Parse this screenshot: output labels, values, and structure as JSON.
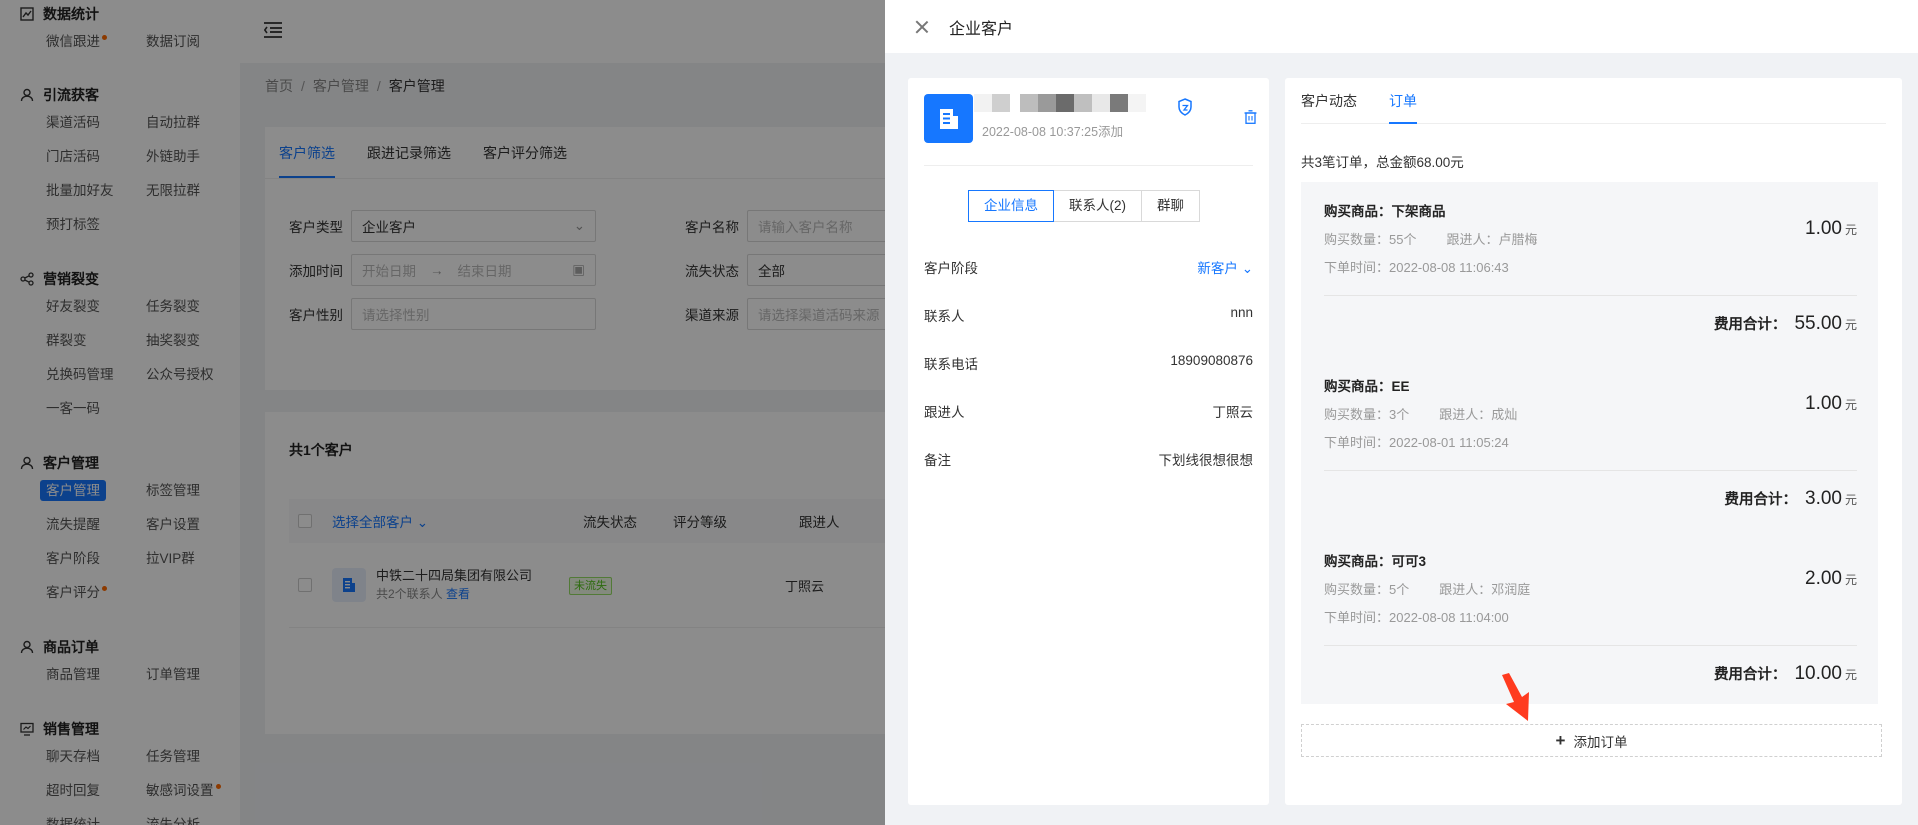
{
  "sidebar": {
    "groups": [
      {
        "title": "数据统计",
        "items": [
          "微信跟进",
          "数据订阅"
        ]
      },
      {
        "title": "引流获客",
        "items": [
          "渠道活码",
          "自动拉群",
          "门店活码",
          "外链助手",
          "批量加好友",
          "无限拉群",
          "预打标签"
        ]
      },
      {
        "title": "营销裂变",
        "items": [
          "好友裂变",
          "任务裂变",
          "群裂变",
          "抽奖裂变",
          "兑换码管理",
          "公众号授权",
          "一客一码"
        ]
      },
      {
        "title": "客户管理",
        "items": [
          "客户管理",
          "标签管理",
          "流失提醒",
          "客户设置",
          "客户阶段",
          "拉VIP群",
          "客户评分"
        ]
      },
      {
        "title": "商品订单",
        "items": [
          "商品管理",
          "订单管理"
        ]
      },
      {
        "title": "销售管理",
        "items": [
          "聊天存档",
          "任务管理",
          "超时回复",
          "敏感词设置",
          "数据统计",
          "流失分析"
        ]
      }
    ]
  },
  "breadcrumb": [
    "首页",
    "客户管理",
    "客户管理"
  ],
  "filter": {
    "tabs": [
      "客户筛选",
      "跟进记录筛选",
      "客户评分筛选"
    ],
    "customer_type_label": "客户类型",
    "customer_type_value": "企业客户",
    "customer_name_label": "客户名称",
    "customer_name_placeholder": "请输入客户名称",
    "add_time_label": "添加时间",
    "start_date_placeholder": "开始日期",
    "end_date_placeholder": "结束日期",
    "churn_label": "流失状态",
    "churn_value": "全部",
    "gender_label": "客户性别",
    "gender_placeholder": "请选择性别",
    "source_label": "渠道来源",
    "source_placeholder": "请选择渠道活码来源"
  },
  "list": {
    "count_text": "共1个客户",
    "columns": [
      "选择全部客户",
      "流失状态",
      "评分等级",
      "跟进人"
    ],
    "row": {
      "company": "中铁二十四局集团有限公司",
      "contacts": "共2个联系人",
      "view": "查看",
      "status": "未流失",
      "follower": "丁照云"
    }
  },
  "drawer": {
    "title": "企业客户",
    "add_time": "2022-08-08 10:37:25添加",
    "segments": [
      "企业信息",
      "联系人(2)",
      "群聊"
    ],
    "info": [
      {
        "key": "客户阶段",
        "value": "新客户",
        "link": true
      },
      {
        "key": "联系人",
        "value": "nnn"
      },
      {
        "key": "联系电话",
        "value": "18909080876"
      },
      {
        "key": "跟进人",
        "value": "丁照云"
      },
      {
        "key": "备注",
        "value": "下划线很想很想"
      }
    ],
    "right_tabs": [
      "客户动态",
      "订单"
    ],
    "summary": "共3笔订单，总金额68.00元",
    "labels": {
      "product": "购买商品：",
      "qty": "购买数量：",
      "follower": "跟进人：",
      "time": "下单时间：",
      "total": "费用合计：",
      "yuan": "元"
    },
    "orders": [
      {
        "product": "下架商品",
        "qty": "55个",
        "follower": "卢腊梅",
        "time": "2022-08-08 11:06:43",
        "price": "1.00",
        "total": "55.00"
      },
      {
        "product": "EE",
        "qty": "3个",
        "follower": "成灿",
        "time": "2022-08-01 11:05:24",
        "price": "1.00",
        "total": "3.00"
      },
      {
        "product": "可可3",
        "qty": "5个",
        "follower": "邓润庭",
        "time": "2022-08-08 11:04:00",
        "price": "2.00",
        "total": "10.00"
      }
    ],
    "add_order": "添加订单"
  },
  "colors": {
    "accent": "#1677ff",
    "overlay": "rgba(0,0,0,0.45)",
    "arrow": "#ff3b1f"
  }
}
